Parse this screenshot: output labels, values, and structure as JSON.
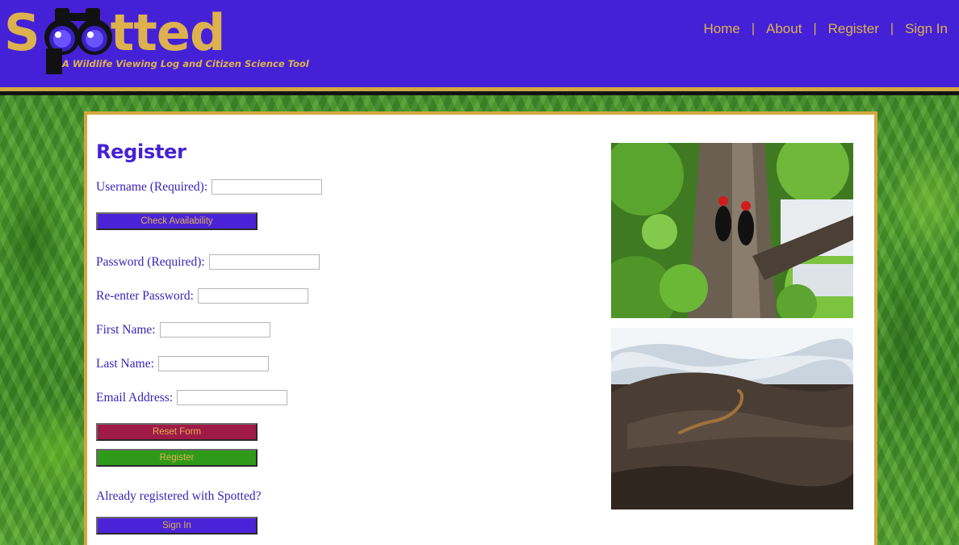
{
  "header": {
    "logo_word": "Spotted",
    "logo_tagline": "A Wildlife Viewing Log and Citizen Science Tool",
    "nav": [
      {
        "label": "Home"
      },
      {
        "label": "About"
      },
      {
        "label": "Register"
      },
      {
        "label": "Sign In"
      }
    ],
    "separator": "|"
  },
  "form": {
    "title": "Register",
    "username_label": "Username (Required):",
    "username_value": "",
    "check_availability_label": "Check Availability",
    "password_label": "Password (Required):",
    "password_value": "",
    "reenter_password_label": "Re-enter Password:",
    "reenter_password_value": "",
    "first_name_label": "First Name:",
    "first_name_value": "",
    "last_name_label": "Last Name:",
    "last_name_value": "",
    "email_label": "Email Address:",
    "email_value": "",
    "reset_label": "Reset Form",
    "register_label": "Register",
    "already_registered_text": "Already registered with Spotted?",
    "sign_in_label": "Sign In"
  },
  "colors": {
    "header_bg": "#4421d6",
    "accent_gold": "#ddb24e",
    "label_text": "#3a1fb8",
    "button_blue": "#4a23d8",
    "button_red": "#a01a48",
    "button_green": "#2f9a1a"
  },
  "icons": {
    "logo_binoculars": "binoculars-icon"
  }
}
